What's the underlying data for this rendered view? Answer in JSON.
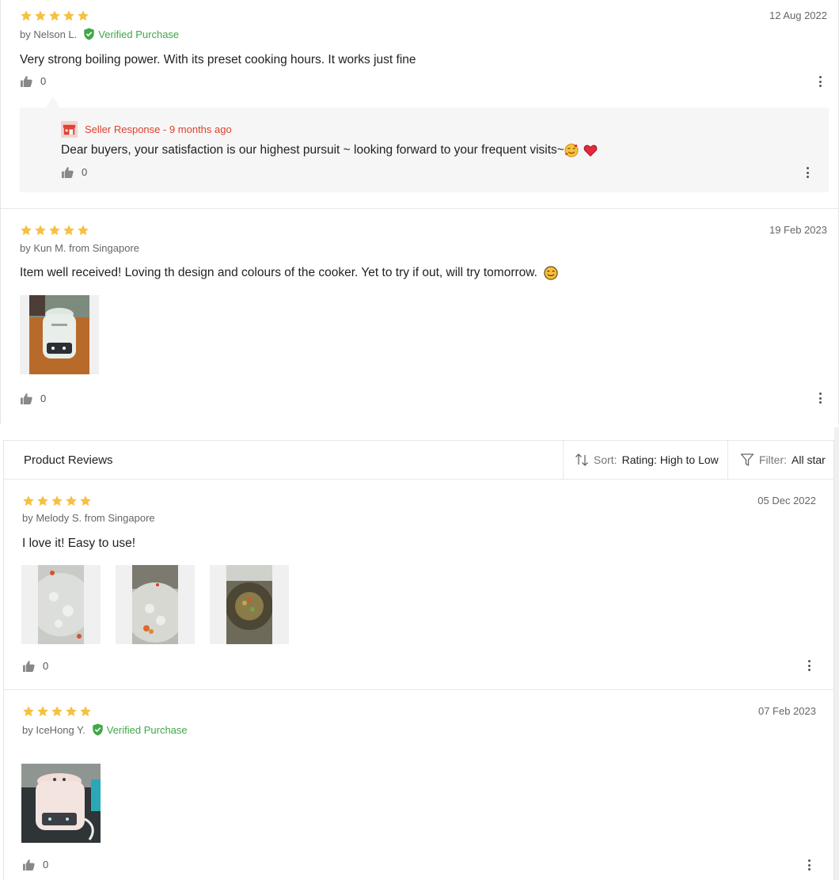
{
  "reviews_top": [
    {
      "rating": 5,
      "date": "12 Aug 2022",
      "author": "by Nelson L.",
      "verified_label": "Verified Purchase",
      "text": "Very strong boiling power. With its preset cooking hours. It works just fine",
      "likes": "0",
      "seller_response": {
        "heading": "Seller Response - 9 months ago",
        "text": "Dear buyers, your satisfaction is our highest pursuit ~ looking forward to your frequent visits~",
        "likes": "0"
      }
    },
    {
      "rating": 5,
      "date": "19 Feb 2023",
      "author": "by Kun M. from Singapore",
      "text": "Item well received! Loving th design and colours of the cooker. Yet to try if out, will try tomorrow.",
      "likes": "0"
    }
  ],
  "toolbar": {
    "title": "Product Reviews",
    "sort_label": "Sort:",
    "sort_value": "Rating: High to Low",
    "filter_label": "Filter:",
    "filter_value": "All star"
  },
  "reviews_bottom": [
    {
      "rating": 5,
      "date": "05 Dec 2022",
      "author": "by Melody S. from Singapore",
      "text": "I love it! Easy to use!",
      "likes": "0",
      "photo_count": 3
    },
    {
      "rating": 5,
      "date": "07 Feb 2023",
      "author": "by IceHong Y.",
      "verified_label": "Verified Purchase",
      "likes": "0",
      "photo_count": 1
    }
  ],
  "colors": {
    "star": "#f5c142",
    "verified": "#3fa847",
    "seller": "#e0402e"
  }
}
